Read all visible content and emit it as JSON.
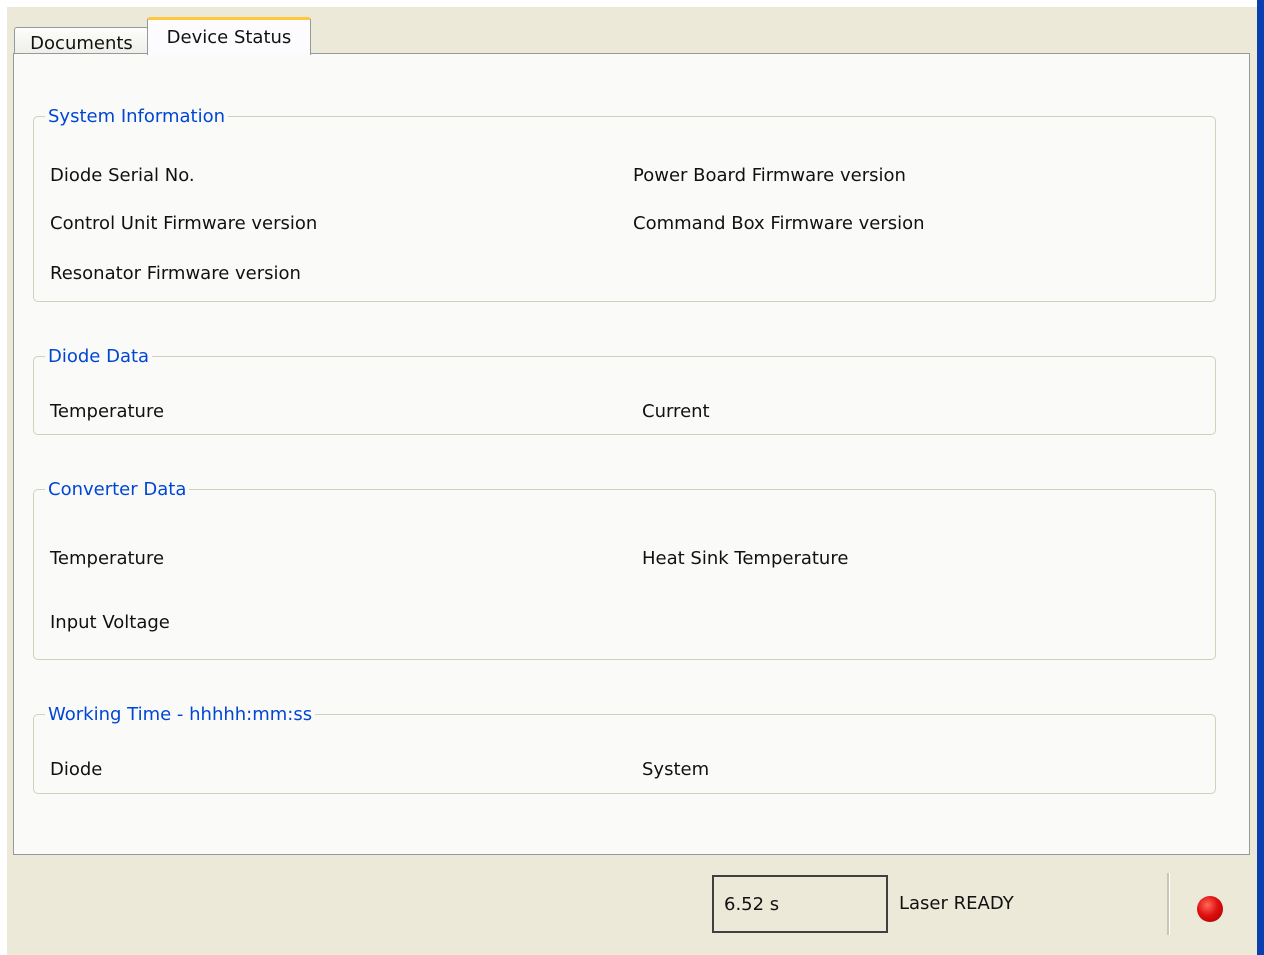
{
  "tabs": {
    "documents": "Documents",
    "device_status": "Device Status"
  },
  "system_information": {
    "legend": "System Information",
    "diode_serial": "Diode Serial No.",
    "control_unit_fw": "Control Unit Firmware version",
    "resonator_fw": "Resonator Firmware version",
    "power_board_fw": "Power Board Firmware version",
    "command_box_fw": "Command Box Firmware version"
  },
  "diode_data": {
    "legend": "Diode Data",
    "temperature": "Temperature",
    "current": "Current"
  },
  "converter_data": {
    "legend": "Converter Data",
    "temperature": "Temperature",
    "input_voltage": "Input Voltage",
    "heat_sink_temperature": "Heat Sink Temperature"
  },
  "working_time": {
    "legend": "Working Time - hhhhh:mm:ss",
    "diode": "Diode",
    "system": "System"
  },
  "status_bar": {
    "time_value": "6.52 s",
    "laser_status": "Laser READY",
    "indicator_color": "#e01010",
    "indicator_icon": "status-led-icon"
  }
}
